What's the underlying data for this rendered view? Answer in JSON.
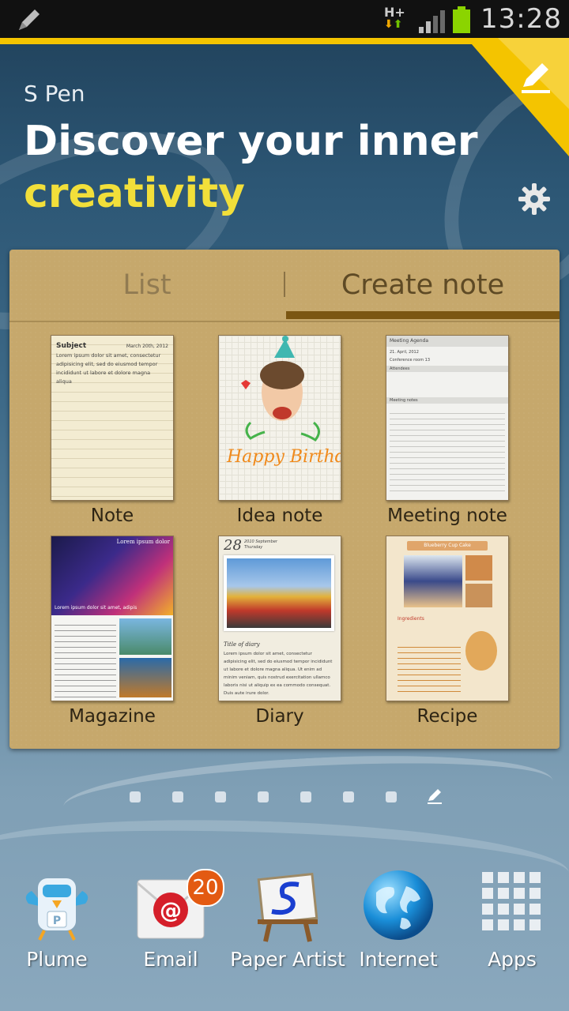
{
  "status_bar": {
    "network_type": "H+",
    "time": "13:28",
    "colors": {
      "battery": "#8bd400",
      "background": "#111111"
    }
  },
  "hero": {
    "brand": "S Pen",
    "headline_line1": "Discover your inner",
    "headline_line2": "creativity",
    "colors": {
      "accent": "#f4c400",
      "highlight": "#f2df3a"
    }
  },
  "widget": {
    "tabs": [
      {
        "label": "List",
        "selected": false
      },
      {
        "label": "Create note",
        "selected": true
      }
    ],
    "templates": [
      {
        "label": "Note",
        "subject": "Subject",
        "date": "March 20th, 2012",
        "body": "Lorem ipsum dolor sit amet, consectetur adipisicing elit, sed do eiusmod tempor incididunt ut labore et dolore magna aliqua"
      },
      {
        "label": "Idea note",
        "text": "Happy Birthday"
      },
      {
        "label": "Meeting note",
        "title": "Meeting Agenda",
        "date": "21. April, 2012",
        "location": "Conference room 13",
        "section1": "Attendees",
        "section2": "Meeting notes"
      },
      {
        "label": "Magazine",
        "headline": "Lorem ipsum dolor",
        "caption": "Lorem ipsum dolor sit amet, adipis"
      },
      {
        "label": "Diary",
        "day": "28",
        "month": "2010 September",
        "weekday": "Thursday",
        "title": "Title of diary",
        "body": "Lorem ipsum dolor sit amet, consectetur adipisicing elit, sed do eiusmod tempor incididunt ut labore et dolore magna aliqua. Ut enim ad minim veniam, quis nostrud exercitation ullamco laboris nisi ut aliquip ex ea commodo consequat. Duis aute irure dolor."
      },
      {
        "label": "Recipe",
        "title": "Blueberry Cup Cake",
        "section": "Ingredients"
      }
    ]
  },
  "page_indicator": {
    "count": 7,
    "current_page_icon": "pen-icon"
  },
  "dock": [
    {
      "label": "Plume",
      "icon": "plume-bird-icon"
    },
    {
      "label": "Email",
      "icon": "email-icon",
      "badge": "20"
    },
    {
      "label": "Paper Artist",
      "icon": "paper-artist-easel-icon"
    },
    {
      "label": "Internet",
      "icon": "globe-icon"
    },
    {
      "label": "Apps",
      "icon": "apps-grid-icon"
    }
  ]
}
